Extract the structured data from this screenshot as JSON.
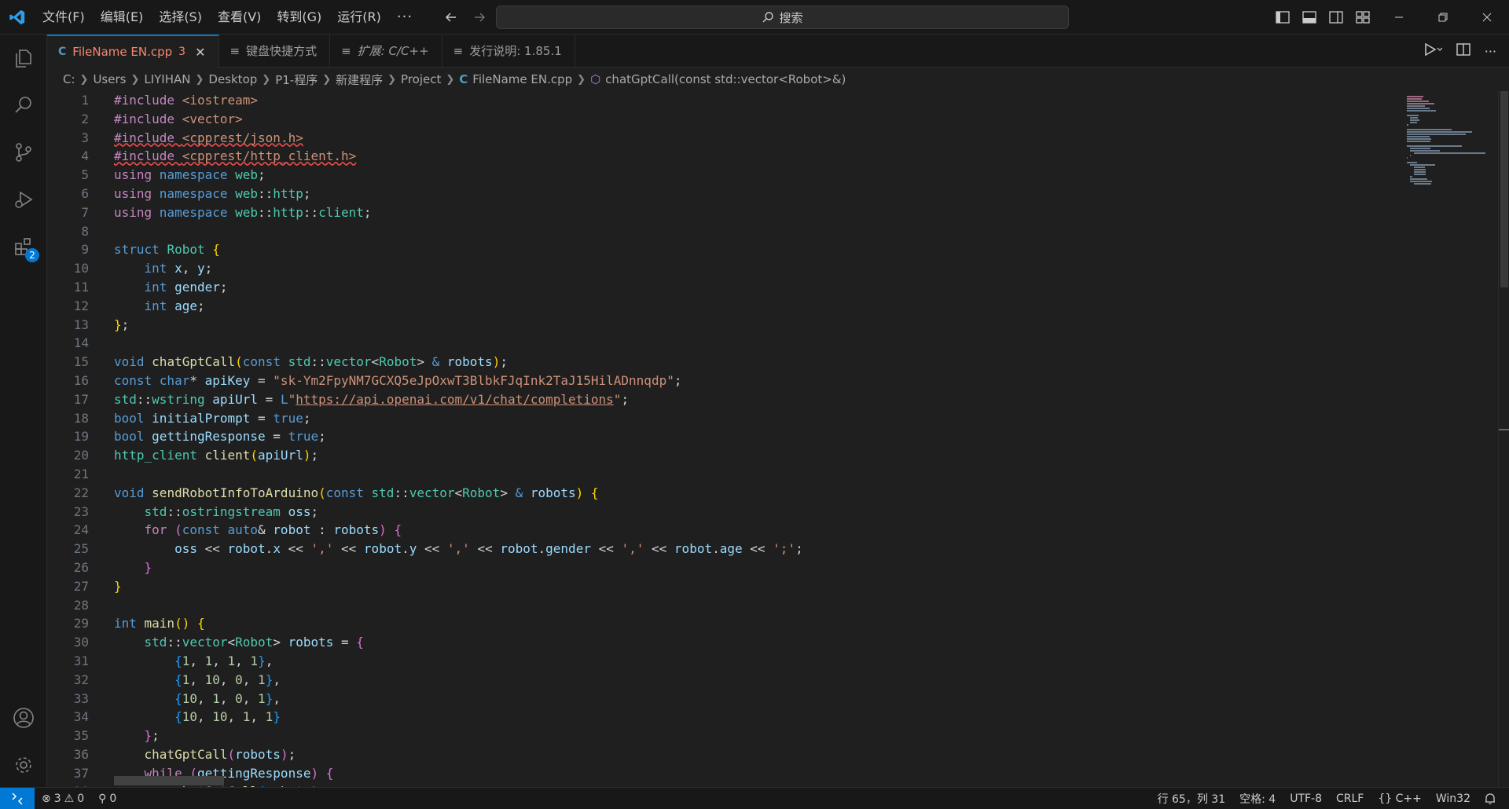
{
  "menu": [
    "文件(F)",
    "编辑(E)",
    "选择(S)",
    "查看(V)",
    "转到(G)",
    "运行(R)"
  ],
  "menu_more": "···",
  "search": {
    "label": "搜索"
  },
  "tabs": [
    {
      "label": "FileName EN.cpp",
      "badge": "3",
      "lang": "C"
    },
    {
      "label": "键盘快捷方式"
    },
    {
      "label": "扩展: C/C++"
    },
    {
      "label": "发行说明: 1.85.1"
    }
  ],
  "breadcrumb": [
    "C:",
    "Users",
    "LIYIHAN",
    "Desktop",
    "P1-程序",
    "新建程序",
    "Project",
    "FileName EN.cpp",
    "chatGptCall(const std::vector<Robot>&)"
  ],
  "activity": {
    "extensions_badge": "2"
  },
  "status": {
    "errors": "3",
    "warnings": "0",
    "ports": "0",
    "cursor": "行 65，列 31",
    "spaces": "空格: 4",
    "encoding": "UTF-8",
    "eol": "CRLF",
    "language": "{} C++",
    "platform": "Win32"
  },
  "colors": {
    "accent": "#0078d4",
    "error": "#f14c4c",
    "modified_tab": "#f48771"
  },
  "code": [
    [
      [
        "pp",
        "#include "
      ],
      [
        "str",
        "<iostream>"
      ]
    ],
    [
      [
        "pp",
        "#include "
      ],
      [
        "str",
        "<vector>"
      ]
    ],
    [
      [
        "pp err",
        "#include "
      ],
      [
        "str err",
        "<cpprest/json.h>"
      ]
    ],
    [
      [
        "pp err",
        "#include "
      ],
      [
        "str err",
        "<cpprest/http_client.h>"
      ]
    ],
    [
      [
        "ctrl",
        "using "
      ],
      [
        "kw",
        "namespace "
      ],
      [
        "ty",
        "web"
      ],
      [
        "",
        "; "
      ]
    ],
    [
      [
        "ctrl",
        "using "
      ],
      [
        "kw",
        "namespace "
      ],
      [
        "ty",
        "web"
      ],
      [
        "",
        "::"
      ],
      [
        "ty",
        "http"
      ],
      [
        "",
        ";"
      ]
    ],
    [
      [
        "ctrl",
        "using "
      ],
      [
        "kw",
        "namespace "
      ],
      [
        "ty",
        "web"
      ],
      [
        "",
        "::"
      ],
      [
        "ty",
        "http"
      ],
      [
        "",
        "::"
      ],
      [
        "ty",
        "client"
      ],
      [
        "",
        ";"
      ]
    ],
    [],
    [
      [
        "kw",
        "struct "
      ],
      [
        "ty",
        "Robot "
      ],
      [
        "br1",
        "{"
      ]
    ],
    [
      [
        "",
        "    "
      ],
      [
        "kw",
        "int "
      ],
      [
        "var",
        "x"
      ],
      [
        "",
        ", "
      ],
      [
        "var",
        "y"
      ],
      [
        "",
        ";"
      ]
    ],
    [
      [
        "",
        "    "
      ],
      [
        "kw",
        "int "
      ],
      [
        "var",
        "gender"
      ],
      [
        "",
        ";"
      ]
    ],
    [
      [
        "",
        "    "
      ],
      [
        "kw",
        "int "
      ],
      [
        "var",
        "age"
      ],
      [
        "",
        ";"
      ]
    ],
    [
      [
        "br1",
        "}"
      ],
      [
        "",
        ";"
      ]
    ],
    [],
    [
      [
        "kw",
        "void "
      ],
      [
        "fn",
        "chatGptCall"
      ],
      [
        "br1",
        "("
      ],
      [
        "kw",
        "const "
      ],
      [
        "ty",
        "std"
      ],
      [
        "",
        "::"
      ],
      [
        "ty",
        "vector"
      ],
      [
        "",
        "<"
      ],
      [
        "ty",
        "Robot"
      ],
      [
        "",
        "> "
      ],
      [
        "kw",
        "& "
      ],
      [
        "var",
        "robots"
      ],
      [
        "br1",
        ")"
      ],
      [
        "",
        ";"
      ]
    ],
    [
      [
        "kw",
        "const "
      ],
      [
        "kw",
        "char"
      ],
      [
        "",
        "* "
      ],
      [
        "var",
        "apiKey"
      ],
      [
        "",
        " = "
      ],
      [
        "str",
        "\"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\""
      ],
      [
        "",
        ";"
      ]
    ],
    [
      [
        "ty",
        "std"
      ],
      [
        "",
        "::"
      ],
      [
        "ty",
        "wstring "
      ],
      [
        "var",
        "apiUrl"
      ],
      [
        "",
        " = "
      ],
      [
        "kw",
        "L"
      ],
      [
        "str",
        "\""
      ],
      [
        "str url",
        "https://api.openai.com/v1/chat/completions"
      ],
      [
        "str",
        "\""
      ],
      [
        "",
        ";"
      ]
    ],
    [
      [
        "kw",
        "bool "
      ],
      [
        "var",
        "initialPrompt"
      ],
      [
        "",
        " = "
      ],
      [
        "kw",
        "true"
      ],
      [
        "",
        ";"
      ]
    ],
    [
      [
        "kw",
        "bool "
      ],
      [
        "var",
        "gettingResponse"
      ],
      [
        "",
        " = "
      ],
      [
        "kw",
        "true"
      ],
      [
        "",
        ";"
      ]
    ],
    [
      [
        "ty",
        "http_client "
      ],
      [
        "fn",
        "client"
      ],
      [
        "br1",
        "("
      ],
      [
        "var",
        "apiUrl"
      ],
      [
        "br1",
        ")"
      ],
      [
        "",
        ";"
      ]
    ],
    [],
    [
      [
        "kw",
        "void "
      ],
      [
        "fn",
        "sendRobotInfoToArduino"
      ],
      [
        "br1",
        "("
      ],
      [
        "kw",
        "const "
      ],
      [
        "ty",
        "std"
      ],
      [
        "",
        "::"
      ],
      [
        "ty",
        "vector"
      ],
      [
        "",
        "<"
      ],
      [
        "ty",
        "Robot"
      ],
      [
        "",
        "> "
      ],
      [
        "kw",
        "& "
      ],
      [
        "var",
        "robots"
      ],
      [
        "br1",
        ") "
      ],
      [
        "br1",
        "{"
      ]
    ],
    [
      [
        "",
        "    "
      ],
      [
        "ty",
        "std"
      ],
      [
        "",
        "::"
      ],
      [
        "ty",
        "ostringstream "
      ],
      [
        "var",
        "oss"
      ],
      [
        "",
        ";"
      ]
    ],
    [
      [
        "",
        "    "
      ],
      [
        "ctrl",
        "for "
      ],
      [
        "br2",
        "("
      ],
      [
        "kw",
        "const "
      ],
      [
        "kw",
        "auto"
      ],
      [
        "",
        "& "
      ],
      [
        "var",
        "robot"
      ],
      [
        "",
        " : "
      ],
      [
        "var",
        "robots"
      ],
      [
        "br2",
        ") "
      ],
      [
        "br2",
        "{"
      ]
    ],
    [
      [
        "",
        "        "
      ],
      [
        "var",
        "oss"
      ],
      [
        "",
        " << "
      ],
      [
        "var",
        "robot"
      ],
      [
        "",
        "."
      ],
      [
        "var",
        "x"
      ],
      [
        "",
        " << "
      ],
      [
        "str",
        "','"
      ],
      [
        "",
        " << "
      ],
      [
        "var",
        "robot"
      ],
      [
        "",
        "."
      ],
      [
        "var",
        "y"
      ],
      [
        "",
        " << "
      ],
      [
        "str",
        "','"
      ],
      [
        "",
        " << "
      ],
      [
        "var",
        "robot"
      ],
      [
        "",
        "."
      ],
      [
        "var",
        "gender"
      ],
      [
        "",
        " << "
      ],
      [
        "str",
        "','"
      ],
      [
        "",
        " << "
      ],
      [
        "var",
        "robot"
      ],
      [
        "",
        "."
      ],
      [
        "var",
        "age"
      ],
      [
        "",
        " << "
      ],
      [
        "str",
        "';'"
      ],
      [
        "",
        ";"
      ]
    ],
    [
      [
        "",
        "    "
      ],
      [
        "br2",
        "}"
      ]
    ],
    [
      [
        "br1",
        "}"
      ]
    ],
    [],
    [
      [
        "kw",
        "int "
      ],
      [
        "fn",
        "main"
      ],
      [
        "br1",
        "() "
      ],
      [
        "br1",
        "{"
      ]
    ],
    [
      [
        "",
        "    "
      ],
      [
        "ty",
        "std"
      ],
      [
        "",
        "::"
      ],
      [
        "ty",
        "vector"
      ],
      [
        "",
        "<"
      ],
      [
        "ty",
        "Robot"
      ],
      [
        "",
        "> "
      ],
      [
        "var",
        "robots"
      ],
      [
        "",
        " = "
      ],
      [
        "br2",
        "{"
      ]
    ],
    [
      [
        "",
        "        "
      ],
      [
        "br3",
        "{"
      ],
      [
        "num",
        "1"
      ],
      [
        "",
        ", "
      ],
      [
        "num",
        "1"
      ],
      [
        "",
        ", "
      ],
      [
        "num",
        "1"
      ],
      [
        "",
        ", "
      ],
      [
        "num",
        "1"
      ],
      [
        "br3",
        "}"
      ],
      [
        "",
        ","
      ]
    ],
    [
      [
        "",
        "        "
      ],
      [
        "br3",
        "{"
      ],
      [
        "num",
        "1"
      ],
      [
        "",
        ", "
      ],
      [
        "num",
        "10"
      ],
      [
        "",
        ", "
      ],
      [
        "num",
        "0"
      ],
      [
        "",
        ", "
      ],
      [
        "num",
        "1"
      ],
      [
        "br3",
        "}"
      ],
      [
        "",
        ","
      ]
    ],
    [
      [
        "",
        "        "
      ],
      [
        "br3",
        "{"
      ],
      [
        "num",
        "10"
      ],
      [
        "",
        ", "
      ],
      [
        "num",
        "1"
      ],
      [
        "",
        ", "
      ],
      [
        "num",
        "0"
      ],
      [
        "",
        ", "
      ],
      [
        "num",
        "1"
      ],
      [
        "br3",
        "}"
      ],
      [
        "",
        ","
      ]
    ],
    [
      [
        "",
        "        "
      ],
      [
        "br3",
        "{"
      ],
      [
        "num",
        "10"
      ],
      [
        "",
        ", "
      ],
      [
        "num",
        "10"
      ],
      [
        "",
        ", "
      ],
      [
        "num",
        "1"
      ],
      [
        "",
        ", "
      ],
      [
        "num",
        "1"
      ],
      [
        "br3",
        "}"
      ]
    ],
    [
      [
        "",
        "    "
      ],
      [
        "br2",
        "}"
      ],
      [
        "",
        ";"
      ]
    ],
    [
      [
        "",
        "    "
      ],
      [
        "fn",
        "chatGptCall"
      ],
      [
        "br2",
        "("
      ],
      [
        "var",
        "robots"
      ],
      [
        "br2",
        ")"
      ],
      [
        "",
        ";"
      ]
    ],
    [
      [
        "",
        "    "
      ],
      [
        "ctrl",
        "while "
      ],
      [
        "br2",
        "("
      ],
      [
        "var",
        "gettingResponse"
      ],
      [
        "br2",
        ") "
      ],
      [
        "br2",
        "{"
      ]
    ],
    [
      [
        "",
        "        "
      ],
      [
        "fn",
        "chatGptCall"
      ],
      [
        "br3",
        "("
      ],
      [
        "var",
        "robots"
      ],
      [
        "br3",
        ")"
      ],
      [
        "",
        ";"
      ]
    ]
  ]
}
